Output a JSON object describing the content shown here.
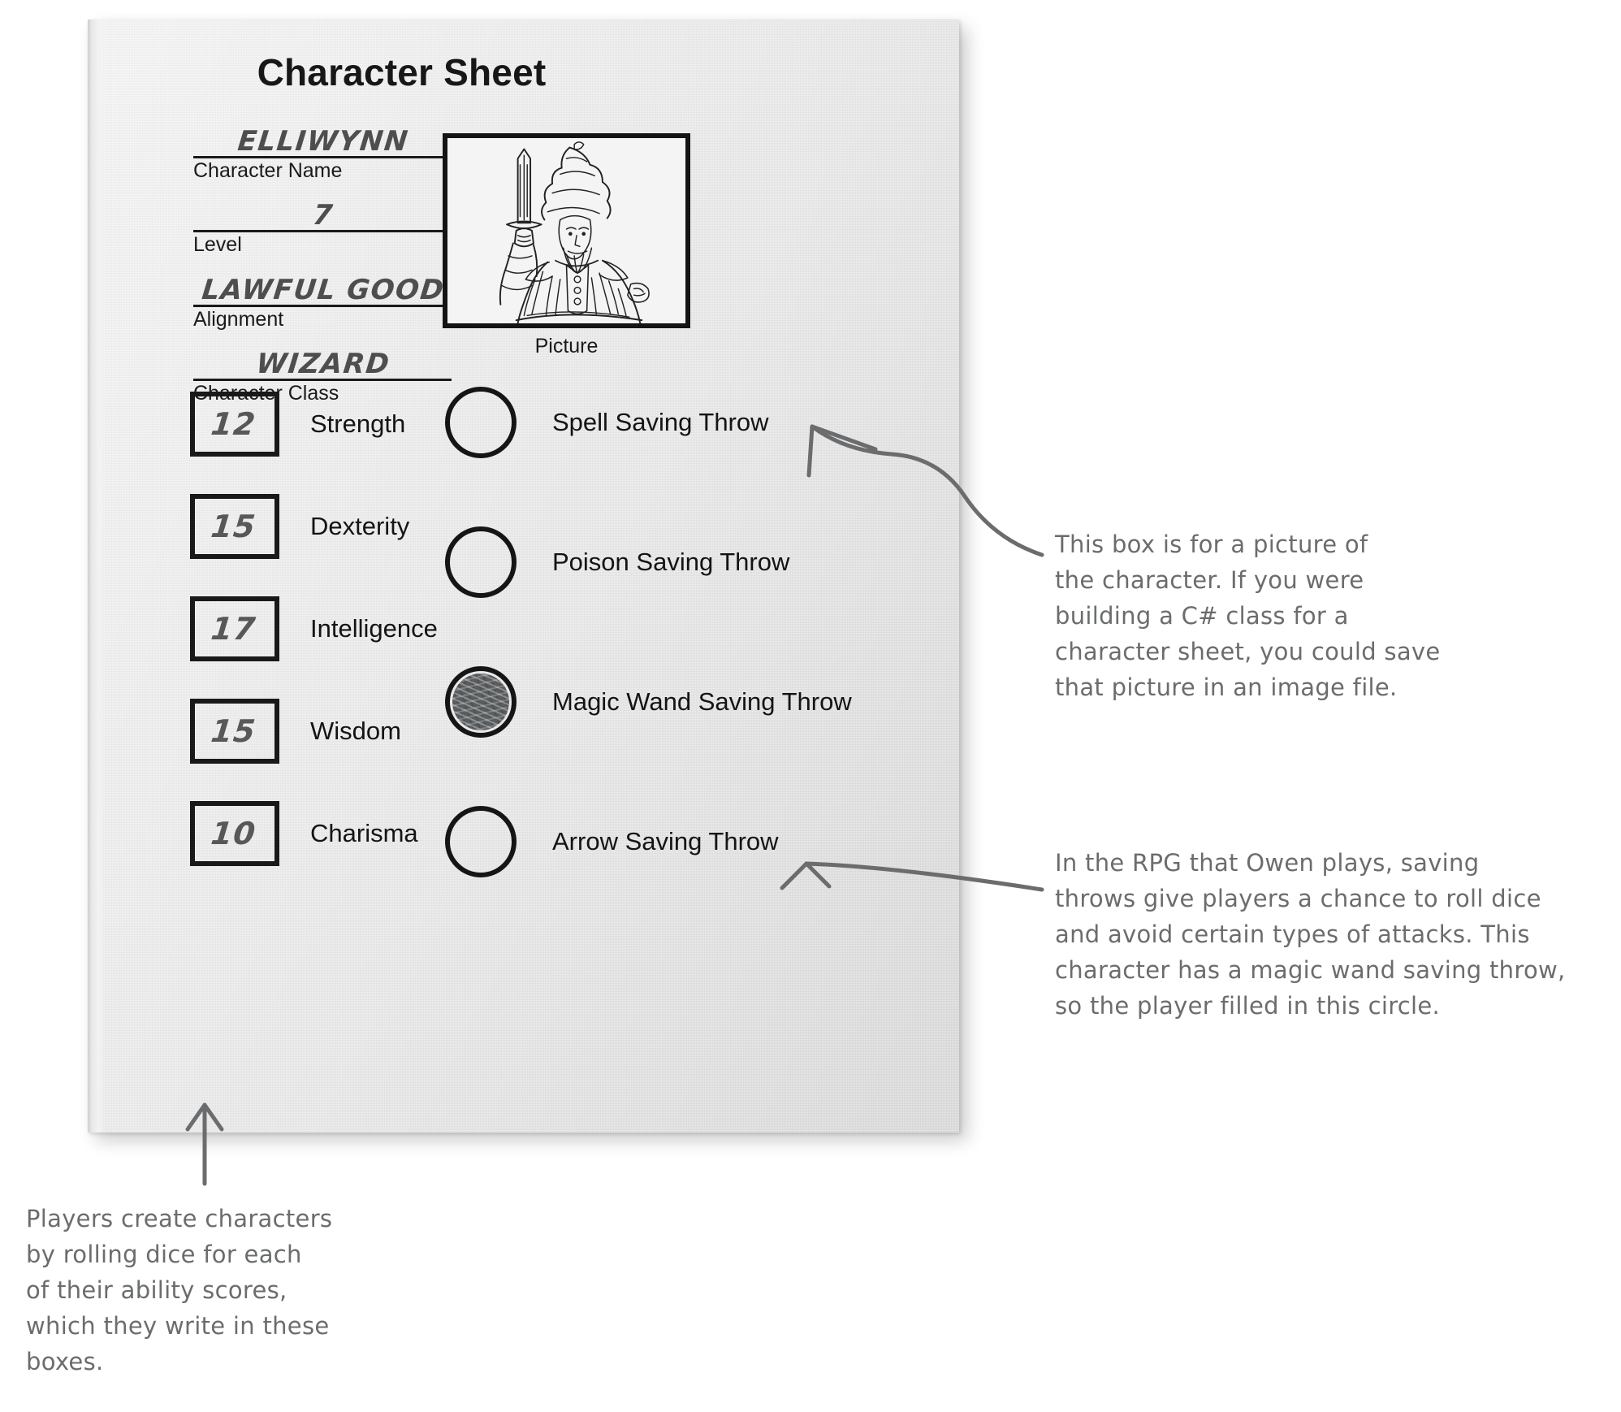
{
  "sheet": {
    "title": "Character Sheet",
    "fields": [
      {
        "value": "ELLIWYNN",
        "caption": "Character Name"
      },
      {
        "value": "7",
        "caption": "Level"
      },
      {
        "value": "LAWFUL GOOD",
        "caption": "Alignment"
      },
      {
        "value": "WIZARD",
        "caption": "Character Class"
      }
    ],
    "picture": {
      "caption": "Picture",
      "alt": "wizard holding a sword"
    },
    "abilities": [
      {
        "score": "12",
        "name": "Strength"
      },
      {
        "score": "15",
        "name": "Dexterity"
      },
      {
        "score": "17",
        "name": "Intelligence"
      },
      {
        "score": "15",
        "name": "Wisdom"
      },
      {
        "score": "10",
        "name": "Charisma"
      }
    ],
    "saving_throws": [
      {
        "label": "Spell Saving\nThrow",
        "filled": false
      },
      {
        "label": "Poison\nSaving Throw",
        "filled": false
      },
      {
        "label": "Magic Wand\nSaving Throw",
        "filled": true
      },
      {
        "label": "Arrow Saving\nThrow",
        "filled": false
      }
    ]
  },
  "annotations": {
    "picture_note": "This box is for a picture of\nthe character. If you were\nbuilding a C# class for a\ncharacter sheet, you could save\nthat picture in an image file.",
    "saving_throw_note": "In the RPG that Owen plays, saving\nthrows give players a chance to roll dice\nand avoid certain types of attacks. This\ncharacter has a magic wand saving throw,\nso the player filled in this circle.",
    "ability_boxes_note": "Players create characters\nby rolling dice for each\nof their ability scores,\nwhich they write in these\nboxes."
  },
  "colors": {
    "ink": "#141414",
    "pencil": "#585858",
    "annotation": "#6a6c6e",
    "paper": "#e9e9e9",
    "fill": "#5a5d5f"
  }
}
